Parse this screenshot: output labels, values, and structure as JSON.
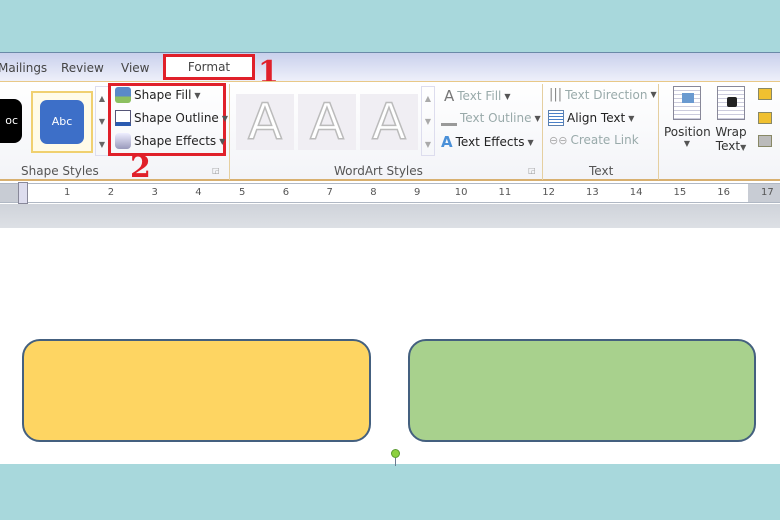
{
  "tabs": [
    "Mailings",
    "Review",
    "View",
    "Format"
  ],
  "annotations": [
    "1",
    "2"
  ],
  "shape_styles": {
    "gallery": [
      "Abc",
      "Abc"
    ],
    "fill": "Shape Fill",
    "outline": "Shape Outline",
    "effects": "Shape Effects",
    "group": "Shape Styles"
  },
  "wordart": {
    "glyphs": [
      "A",
      "A",
      "A"
    ],
    "text_fill": "Text Fill",
    "text_outline": "Text Outline",
    "text_effects": "Text Effects",
    "group": "WordArt Styles"
  },
  "text_group": {
    "direction": "Text Direction",
    "align": "Align Text",
    "link": "Create Link",
    "group": "Text"
  },
  "arrange": {
    "position": "Position",
    "wrap": "Wrap",
    "wrap2": "Text"
  },
  "ruler": [
    "1",
    "2",
    "3",
    "4",
    "5",
    "6",
    "7",
    "8",
    "9",
    "10",
    "11",
    "12",
    "13",
    "14",
    "15",
    "16",
    "17"
  ],
  "colors": {
    "shape_left": "#fed562",
    "shape_right": "#a8d18d",
    "highlight": "#e0202a",
    "background": "#a8d8dc"
  }
}
